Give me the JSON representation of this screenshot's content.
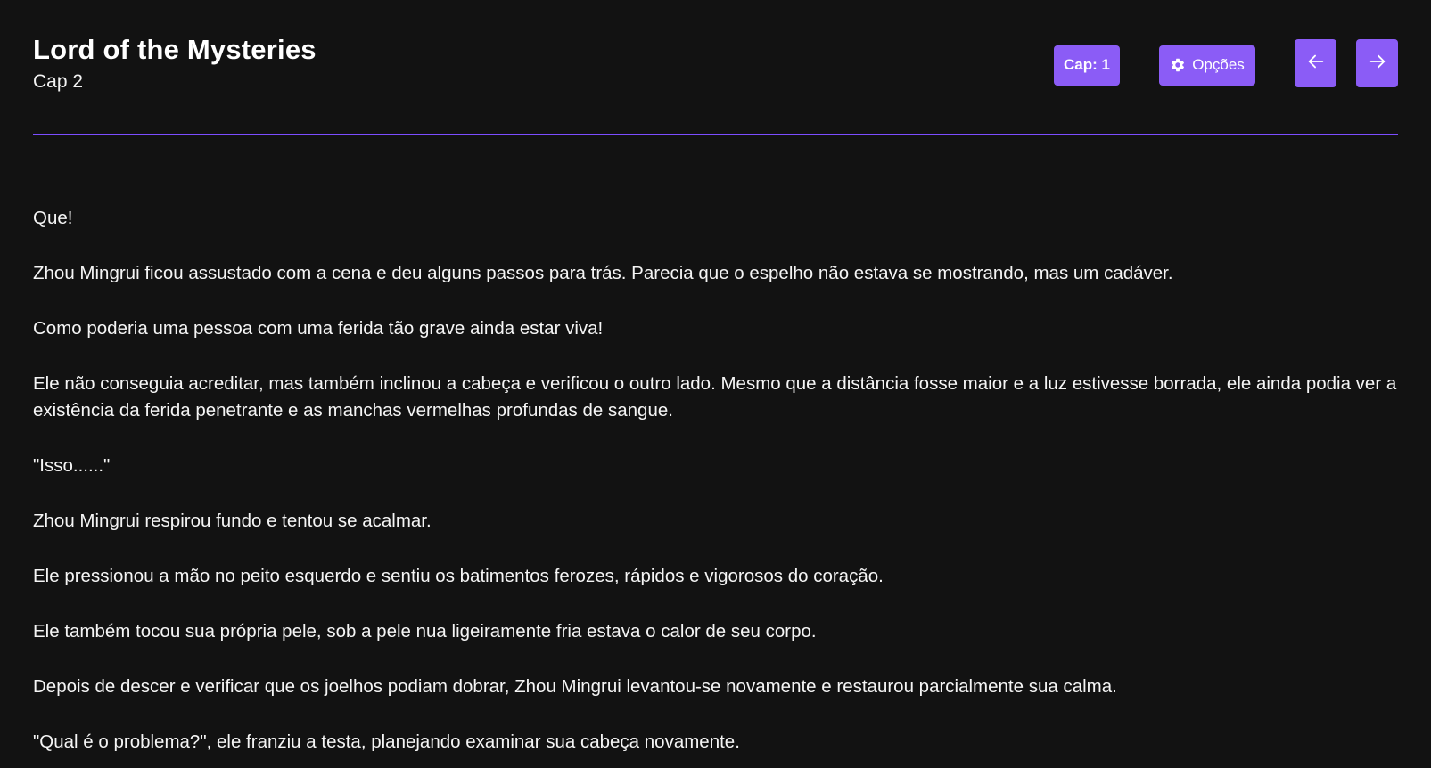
{
  "header": {
    "title": "Lord of the Mysteries",
    "subtitle": "Cap 2"
  },
  "controls": {
    "chapter_label": "Cap: 1",
    "options_label": "Opções",
    "prev_icon": "arrow-left-icon",
    "next_icon": "arrow-right-icon"
  },
  "colors": {
    "background": "#121212",
    "accent": "#8b5cf6",
    "divider": "#7c4dff",
    "text": "#ffffff"
  },
  "content": {
    "paragraphs": [
      "Que!",
      "Zhou Mingrui ficou assustado com a cena e deu alguns passos para trás. Parecia que o espelho não estava se mostrando, mas um cadáver.",
      "Como poderia uma pessoa com uma ferida tão grave ainda estar viva!",
      "Ele não conseguia acreditar, mas também inclinou a cabeça e verificou o outro lado. Mesmo que a distância fosse maior e a luz estivesse borrada, ele ainda podia ver a existência da ferida penetrante e as manchas vermelhas profundas de sangue.",
      "\"Isso......\"",
      "Zhou Mingrui respirou fundo e tentou se acalmar.",
      "Ele pressionou a mão no peito esquerdo e sentiu os batimentos ferozes, rápidos e vigorosos do coração.",
      "Ele também tocou sua própria pele, sob a pele nua ligeiramente fria estava o calor de seu corpo.",
      "Depois de descer e verificar que os joelhos podiam dobrar, Zhou Mingrui levantou-se novamente e restaurou parcialmente sua calma.",
      "\"Qual é o problema?\", ele franziu a testa, planejando examinar sua cabeça novamente."
    ]
  }
}
